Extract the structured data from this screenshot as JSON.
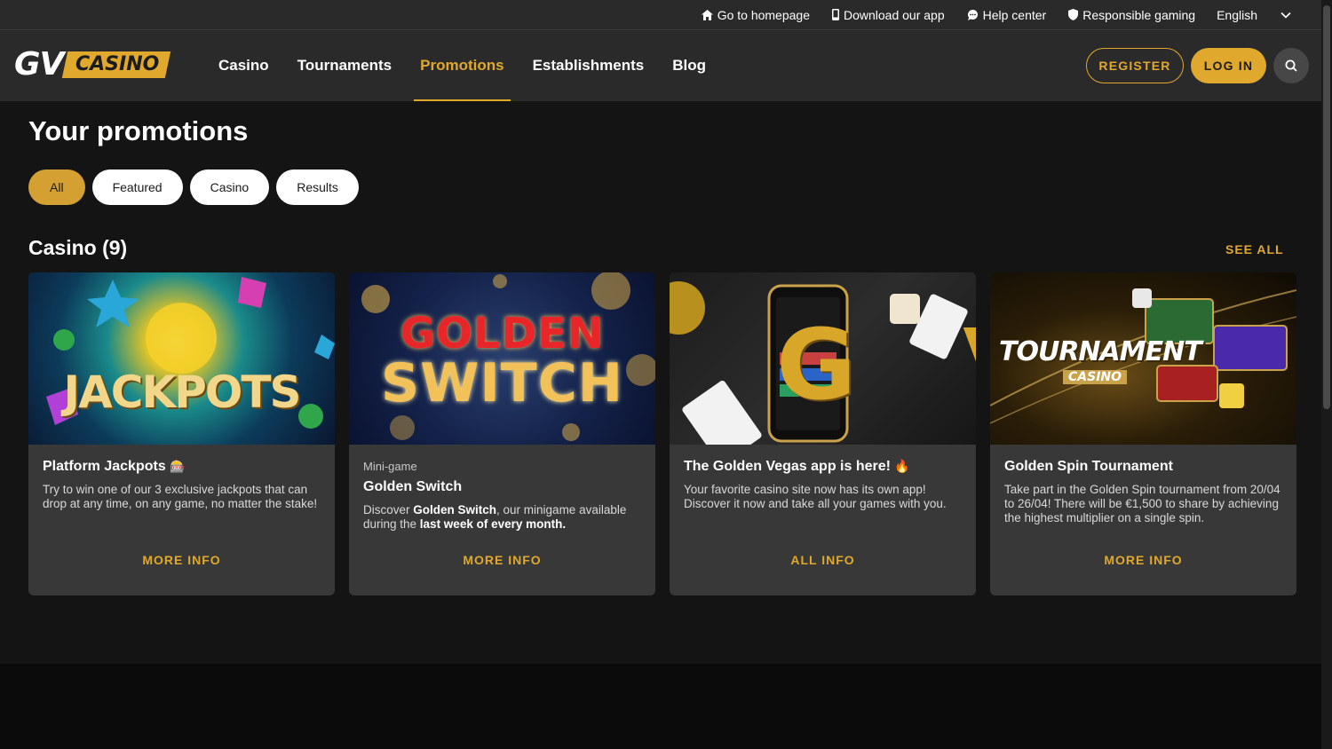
{
  "topbar": {
    "links": [
      {
        "label": "Go to homepage",
        "icon": "home-icon"
      },
      {
        "label": "Download our app",
        "icon": "phone-icon"
      },
      {
        "label": "Help center",
        "icon": "chat-icon"
      },
      {
        "label": "Responsible gaming",
        "icon": "shield-icon"
      }
    ],
    "language": "English"
  },
  "header": {
    "logo_gv": "GV",
    "logo_casino": "CASINO",
    "nav": [
      "Casino",
      "Tournaments",
      "Promotions",
      "Establishments",
      "Blog"
    ],
    "active_nav": "Promotions",
    "register": "REGISTER",
    "login": "LOG IN"
  },
  "page": {
    "title": "Your promotions",
    "filters": [
      "All",
      "Featured",
      "Casino",
      "Results"
    ],
    "active_filter": "All",
    "section_title": "Casino (9)",
    "see_all": "SEE ALL"
  },
  "cards": [
    {
      "kicker": "",
      "title": "Platform Jackpots",
      "title_emoji": "🎰",
      "desc_html_parts": [
        {
          "t": "Try to win one of our 3 exclusive jackpots that can drop at any time, on any game, no matter the stake!",
          "b": false
        }
      ],
      "link": "MORE INFO",
      "image_text": "JACKPOTS"
    },
    {
      "kicker": "Mini-game",
      "title": "Golden Switch",
      "title_emoji": "",
      "desc_html_parts": [
        {
          "t": "Discover ",
          "b": false
        },
        {
          "t": "Golden Switch",
          "b": true
        },
        {
          "t": ", our minigame available during the ",
          "b": false
        },
        {
          "t": "last week of every month.",
          "b": true
        }
      ],
      "link": "MORE INFO",
      "image_text": "GOLDEN SWITCH"
    },
    {
      "kicker": "",
      "title": "The Golden Vegas app is here!",
      "title_emoji": "🔥",
      "desc_html_parts": [
        {
          "t": "Your favorite casino site now has its own app! Discover it now and take all your games with you.",
          "b": false
        }
      ],
      "link": "ALL INFO",
      "image_text": "GV"
    },
    {
      "kicker": "",
      "title": "Golden Spin Tournament",
      "title_emoji": "",
      "desc_html_parts": [
        {
          "t": "Take part in the Golden Spin tournament from 20/04 to 26/04! There will be €1,500 to share by achieving the highest multiplier on a single spin.",
          "b": false
        }
      ],
      "link": "MORE INFO",
      "image_text": "TOURNAMENT",
      "image_subtext": "CASINO"
    }
  ],
  "colors": {
    "accent": "#e0a92e",
    "bg": "#141414",
    "card": "#383838",
    "header": "#2a2a2a"
  }
}
